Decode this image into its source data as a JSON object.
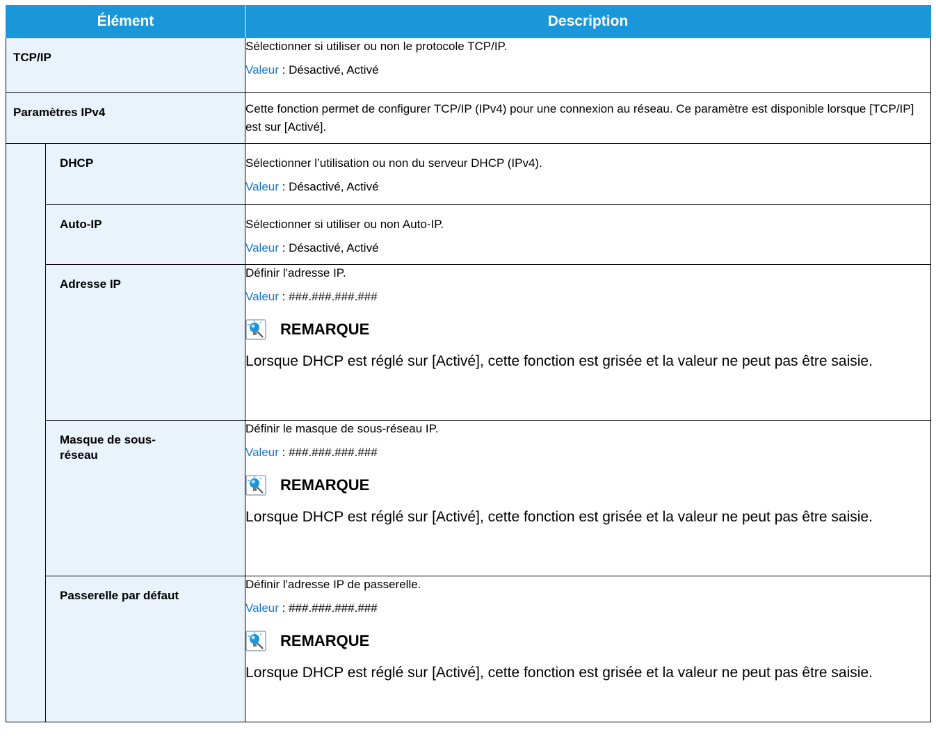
{
  "header": {
    "col1": "Élément",
    "col2": "Description"
  },
  "value_prefix": "Valeur",
  "value_sep": " : ",
  "note": {
    "title": "REMARQUE",
    "icon": "lightbulb-note-icon"
  },
  "rows": [
    {
      "label": "TCP/IP",
      "desc": "Sélectionner si utiliser ou non le protocole TCP/IP.",
      "value": "Désactivé, Activé"
    },
    {
      "label": "Paramètres IPv4",
      "desc": "Cette fonction permet de configurer TCP/IP (IPv4) pour une connexion au réseau. Ce paramètre est disponible lorsque [TCP/IP] est sur [Activé]."
    }
  ],
  "subrows": [
    {
      "label": "DHCP",
      "desc": "Sélectionner l’utilisation ou non du serveur DHCP (IPv4).",
      "value": "Désactivé, Activé"
    },
    {
      "label": "Auto-IP",
      "desc": "Sélectionner si utiliser ou non Auto-IP.",
      "value": "Désactivé, Activé"
    },
    {
      "label": "Adresse IP",
      "desc": "Définir l'adresse IP.",
      "value": "###.###.###.###",
      "note_text": "Lorsque DHCP est réglé sur [Activé], cette fonction est grisée et la valeur ne peut pas être saisie."
    },
    {
      "label": "Masque de sous-réseau",
      "desc": "Définir le masque de sous-réseau IP.",
      "value": "###.###.###.###",
      "note_text": "Lorsque DHCP est réglé sur [Activé], cette fonction est grisée et la valeur ne peut pas être saisie."
    },
    {
      "label": "Passerelle par défaut",
      "desc": "Définir l'adresse IP de passerelle.",
      "value": "###.###.###.###",
      "note_text": "Lorsque DHCP est réglé sur [Activé], cette fonction est grisée et la valeur ne peut pas être saisie."
    }
  ],
  "colors": {
    "header_bg": "#1a97d9",
    "item_bg": "#eaf3fb",
    "value_key": "#1a74d0"
  }
}
